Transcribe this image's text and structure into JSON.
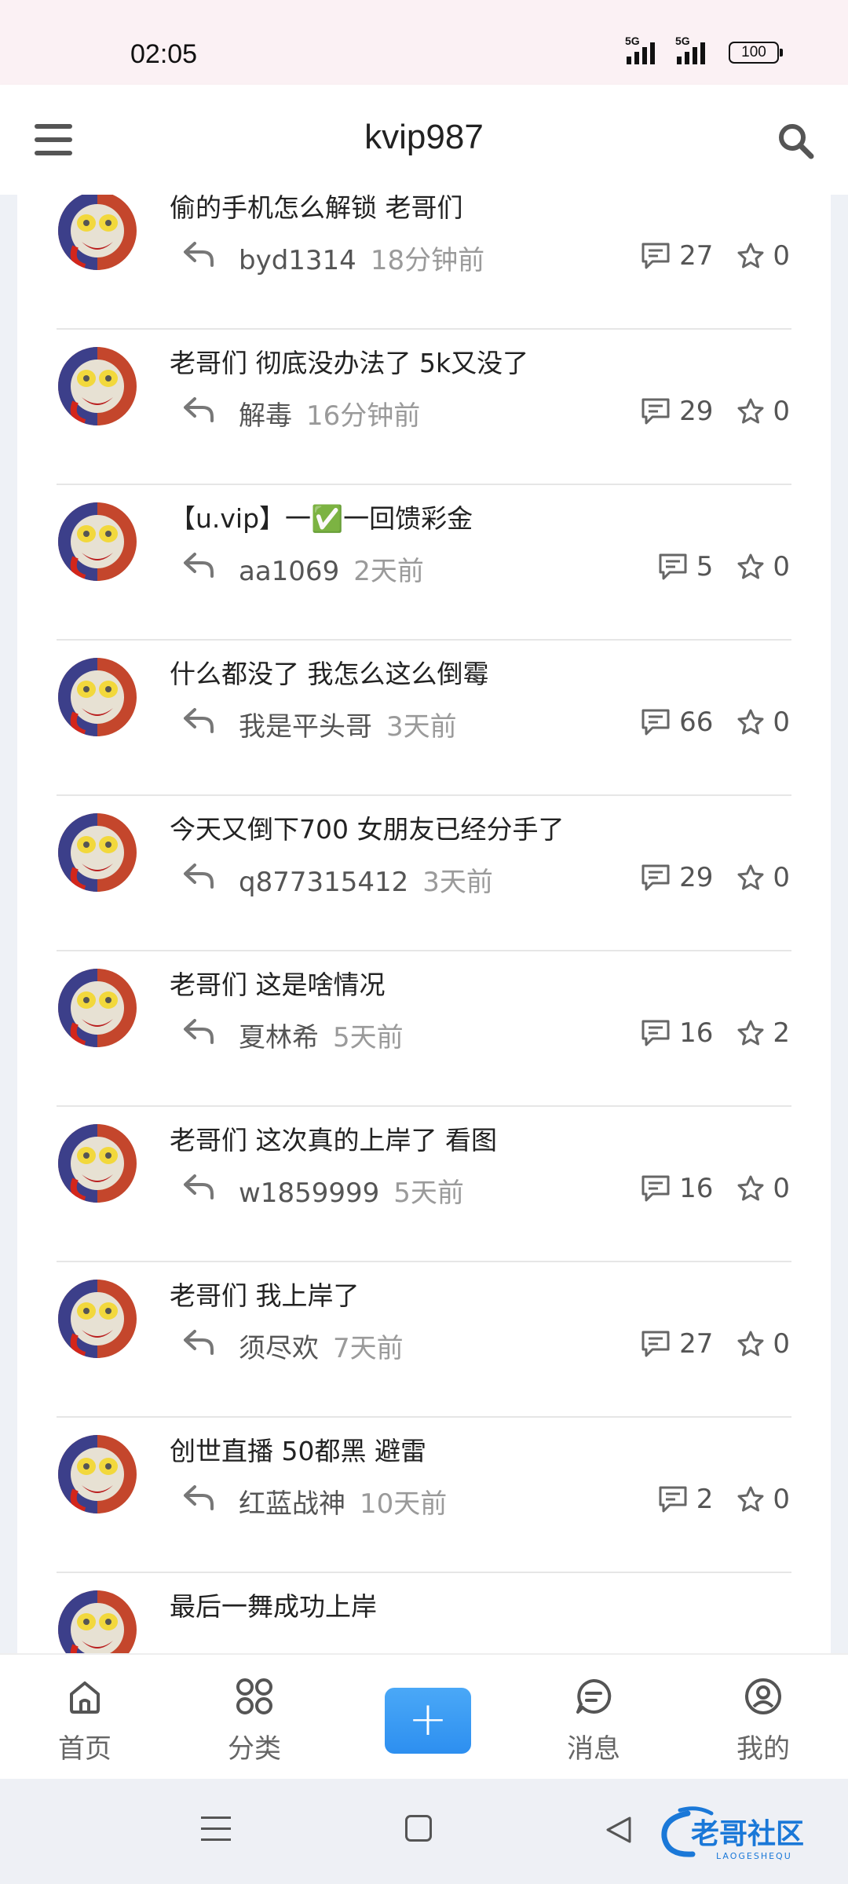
{
  "status_bar": {
    "time": "02:05",
    "signal_1_label": "5G",
    "signal_2_label": "5G",
    "battery": "100"
  },
  "header": {
    "title": "kvip987"
  },
  "posts": [
    {
      "title": "偷的手机怎么解锁 老哥们",
      "author": "byd1314",
      "time": "18分钟前",
      "comments": "27",
      "stars": "0"
    },
    {
      "title": "老哥们 彻底没办法了 5k又没了",
      "author": "解毒",
      "time": "16分钟前",
      "comments": "29",
      "stars": "0"
    },
    {
      "title": "【u.vip】一✅一回馈彩金",
      "author": "aa1069",
      "time": "2天前",
      "comments": "5",
      "stars": "0"
    },
    {
      "title": "什么都没了 我怎么这么倒霉",
      "author": "我是平头哥",
      "time": "3天前",
      "comments": "66",
      "stars": "0"
    },
    {
      "title": "今天又倒下700 女朋友已经分手了",
      "author": "q877315412",
      "time": "3天前",
      "comments": "29",
      "stars": "0"
    },
    {
      "title": "老哥们 这是啥情况",
      "author": "夏林希",
      "time": "5天前",
      "comments": "16",
      "stars": "2"
    },
    {
      "title": "老哥们 这次真的上岸了 看图",
      "author": "w1859999",
      "time": "5天前",
      "comments": "16",
      "stars": "0"
    },
    {
      "title": "老哥们 我上岸了",
      "author": "须尽欢",
      "time": "7天前",
      "comments": "27",
      "stars": "0"
    },
    {
      "title": "创世直播 50都黑 避雷",
      "author": "红蓝战神",
      "time": "10天前",
      "comments": "2",
      "stars": "0"
    },
    {
      "title": "最后一舞成功上岸",
      "author": "",
      "time": "",
      "comments": "",
      "stars": ""
    }
  ],
  "tabbar": {
    "home": "首页",
    "category": "分类",
    "add": "+",
    "messages": "消息",
    "mine": "我的"
  },
  "watermark": {
    "text": "老哥社区",
    "subtext": "LAOGESHEQU"
  },
  "colors": {
    "accent": "#2d8ff0",
    "status_bar_bg": "#fbf1f4",
    "nav_bg": "#eef0f5"
  }
}
